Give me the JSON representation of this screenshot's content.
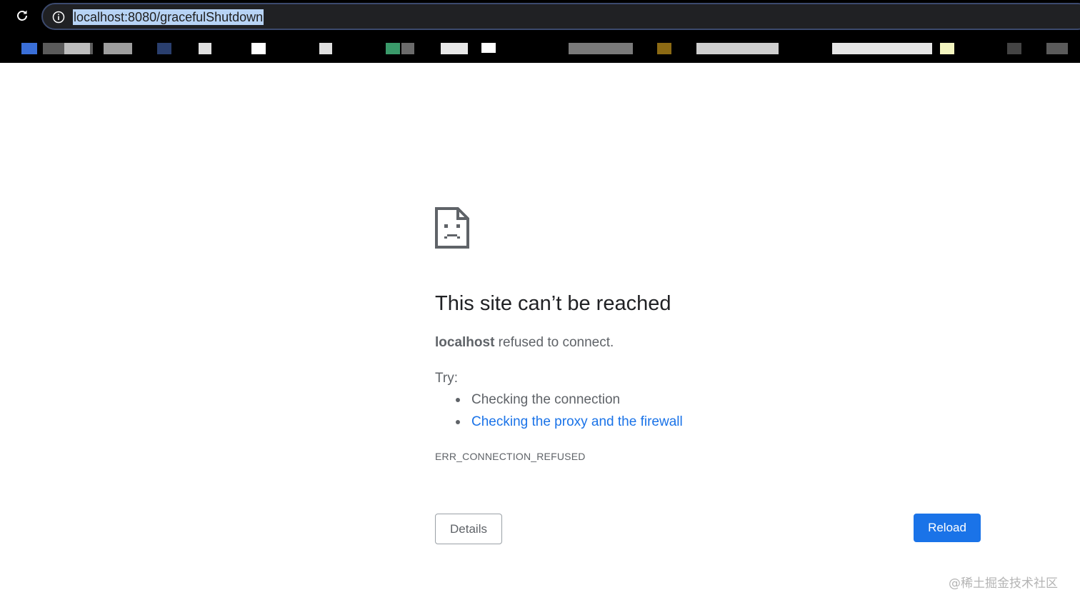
{
  "browser": {
    "url": "localhost:8080/gracefulShutdown",
    "bookmark_colors": [
      "#3a6fd8",
      "#5b5b5b",
      "#bdbdbd",
      "#2a3f6e",
      "#ffffff",
      "#e0e0e0",
      "#3a9a6a",
      "#8c6a14",
      "#f3f5c0",
      "#111a3a",
      "#444444"
    ]
  },
  "error_page": {
    "heading": "This site can’t be reached",
    "host": "localhost",
    "refused_text": " refused to connect.",
    "try_label": "Try:",
    "suggestions": [
      {
        "text": "Checking the connection",
        "is_link": false
      },
      {
        "text": "Checking the proxy and the firewall",
        "is_link": true
      }
    ],
    "error_code": "ERR_CONNECTION_REFUSED",
    "details_label": "Details",
    "reload_label": "Reload"
  },
  "watermark": "@稀土掘金技术社区",
  "colors": {
    "link": "#1a73e8",
    "primary_button": "#1a73e8",
    "text_secondary": "#5f6368",
    "text_primary": "#202124",
    "url_highlight": "#b7d3f5"
  }
}
